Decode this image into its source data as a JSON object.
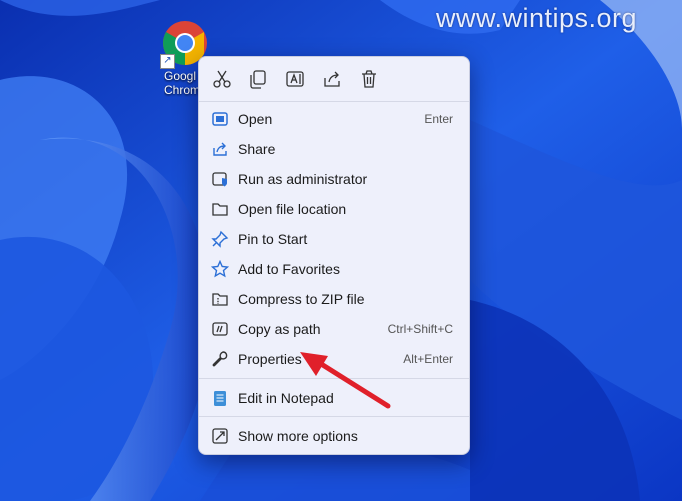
{
  "watermark": "www.wintips.org",
  "desktop": {
    "icon_label": "Googl\nChrom"
  },
  "menu": {
    "toolbar": [
      {
        "name": "cut-icon"
      },
      {
        "name": "copy-icon"
      },
      {
        "name": "rename-icon"
      },
      {
        "name": "share-icon"
      },
      {
        "name": "delete-icon"
      }
    ],
    "items": [
      {
        "label": "Open",
        "accel": "Enter",
        "icon": "open-icon"
      },
      {
        "label": "Share",
        "accel": "",
        "icon": "share-icon"
      },
      {
        "label": "Run as administrator",
        "accel": "",
        "icon": "shield-icon"
      },
      {
        "label": "Open file location",
        "accel": "",
        "icon": "folder-icon"
      },
      {
        "label": "Pin to Start",
        "accel": "",
        "icon": "pin-icon"
      },
      {
        "label": "Add to Favorites",
        "accel": "",
        "icon": "star-icon"
      },
      {
        "label": "Compress to ZIP file",
        "accel": "",
        "icon": "zip-folder-icon"
      },
      {
        "label": "Copy as path",
        "accel": "Ctrl+Shift+C",
        "icon": "copy-path-icon"
      },
      {
        "label": "Properties",
        "accel": "Alt+Enter",
        "icon": "wrench-icon"
      },
      {
        "label": "Edit in Notepad",
        "accel": "",
        "icon": "notepad-icon"
      },
      {
        "label": "Show more options",
        "accel": "",
        "icon": "more-options-icon"
      }
    ]
  },
  "colors": {
    "arrow": "#e0202a",
    "accent": "#2b6fd6"
  }
}
